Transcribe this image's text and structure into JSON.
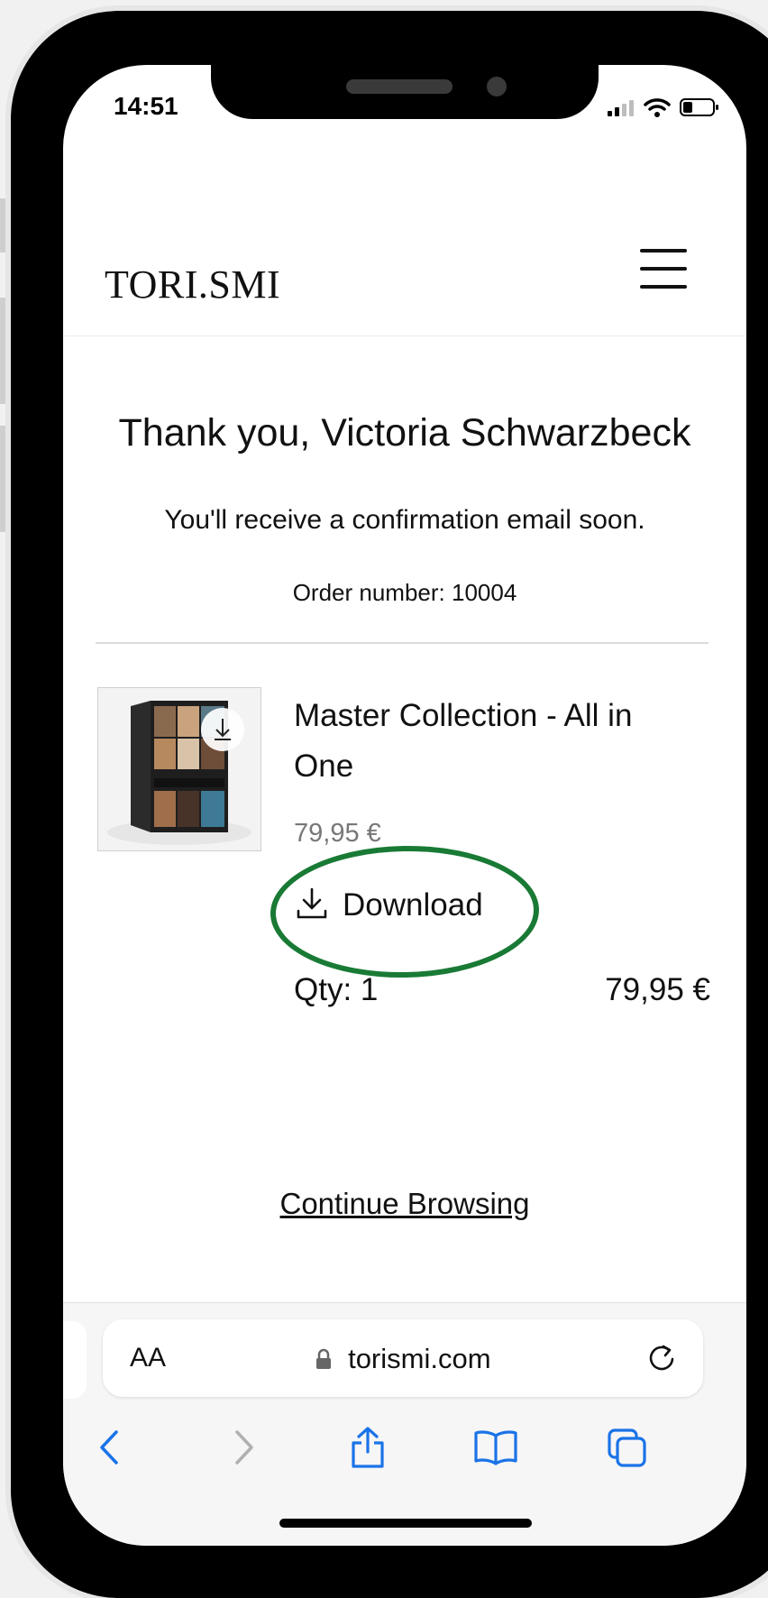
{
  "status_bar": {
    "time": "14:51",
    "icons": [
      "signal-icon",
      "wifi-icon",
      "battery-icon"
    ]
  },
  "header": {
    "logo": "TORI.SMI",
    "menu_icon": "hamburger-menu-icon"
  },
  "confirmation": {
    "title": "Thank you, Victoria Schwarzbeck",
    "message": "You'll receive a confirmation email soon.",
    "order_number": "Order number: 10004"
  },
  "order_item": {
    "name": "Master Collection - All in One",
    "price": "79,95 €",
    "download_label": "Download",
    "qty": "Qty: 1",
    "line_total": "79,95 €",
    "thumbnail_icon": "product-box-image"
  },
  "footer": {
    "continue_label": "Continue Browsing"
  },
  "browser": {
    "text_size_label": "AA",
    "url": "torismi.com",
    "toolbar": [
      "back-icon",
      "forward-icon",
      "share-icon",
      "bookmarks-icon",
      "tabs-icon"
    ]
  },
  "colors": {
    "accent_blue": "#1a73e8",
    "highlight_green": "#197a35",
    "disabled_gray": "#b0b0b0"
  }
}
